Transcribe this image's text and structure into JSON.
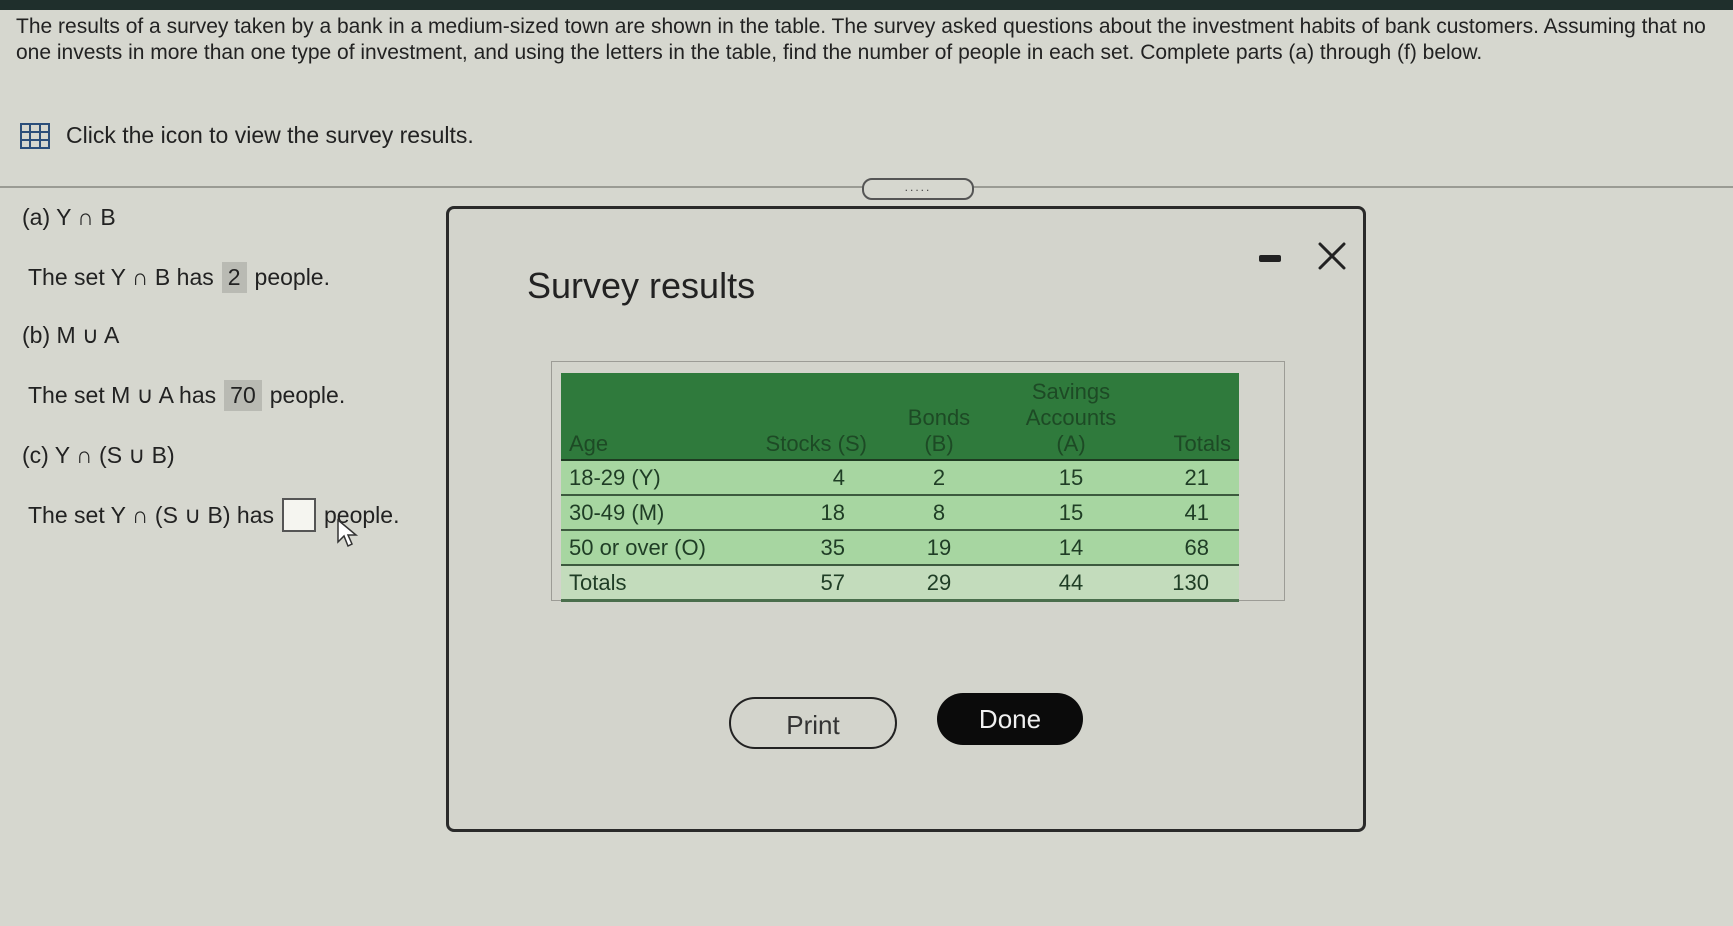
{
  "prompt": {
    "text": "The results of a survey taken by a bank in a medium-sized town are shown in the table. The survey asked questions about the investment habits of bank customers. Assuming that no one invests in more than one type of investment, and using the letters in the table, find the number of people in each set. Complete parts (a) through (f) below.",
    "view_link": "Click the icon to view the survey results.",
    "view_icon": "table-grid-icon"
  },
  "divider_handle": ".....",
  "parts": {
    "a": {
      "label": "(a) Y ∩ B",
      "prefix": "The set Y ∩ B has",
      "answer": "2",
      "suffix": "people."
    },
    "b": {
      "label": "(b) M ∪ A",
      "prefix": "The set M ∪ A has",
      "answer": "70",
      "suffix": "people."
    },
    "c": {
      "label": "(c) Y ∩ (S ∪ B)",
      "prefix": "The set Y ∩ (S ∪ B) has",
      "answer": "",
      "suffix": "people."
    }
  },
  "modal": {
    "title": "Survey results",
    "headers": {
      "age": "Age",
      "stocks": "Stocks (S)",
      "bonds_1": "Bonds",
      "bonds_2": "(B)",
      "savings_1": "Savings",
      "savings_2": "Accounts",
      "savings_3": "(A)",
      "totals": "Totals"
    },
    "rows": [
      {
        "age": "18-29 (Y)",
        "stocks": "4",
        "bonds": "2",
        "savings": "15",
        "totals": "21"
      },
      {
        "age": "30-49 (M)",
        "stocks": "18",
        "bonds": "8",
        "savings": "15",
        "totals": "41"
      },
      {
        "age": "50 or over (O)",
        "stocks": "35",
        "bonds": "19",
        "savings": "14",
        "totals": "68"
      },
      {
        "age": "Totals",
        "stocks": "57",
        "bonds": "29",
        "savings": "44",
        "totals": "130"
      }
    ],
    "print_label": "Print",
    "done_label": "Done"
  },
  "colors": {
    "header_green": "#2f7a3c",
    "row_green": "#a7d6a1",
    "done_black": "#0b0b0b",
    "background": "#d6d7cf"
  }
}
